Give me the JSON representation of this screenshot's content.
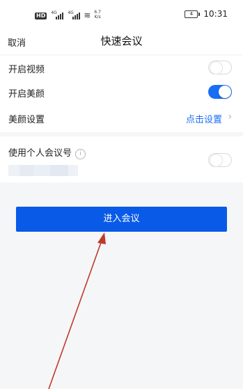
{
  "status_bar": {
    "hd": "HD",
    "network1": "4G",
    "network2": "4G",
    "speed_value": "6.7",
    "speed_unit": "K/s",
    "battery": "4",
    "time": "10:31"
  },
  "nav": {
    "cancel_label": "取消",
    "title": "快速会议"
  },
  "settings": {
    "video_label": "开启视频",
    "video_enabled": false,
    "beauty_label": "开启美颜",
    "beauty_enabled": true,
    "beauty_settings_label": "美颜设置",
    "beauty_settings_link": "点击设置"
  },
  "personal": {
    "label": "使用个人会议号",
    "info_icon": "i",
    "enabled": false
  },
  "actions": {
    "join_label": "进入会议"
  },
  "colors": {
    "accent": "#1a6ef6",
    "button": "#0a5ae8",
    "annotation_arrow": "#c0392b"
  }
}
